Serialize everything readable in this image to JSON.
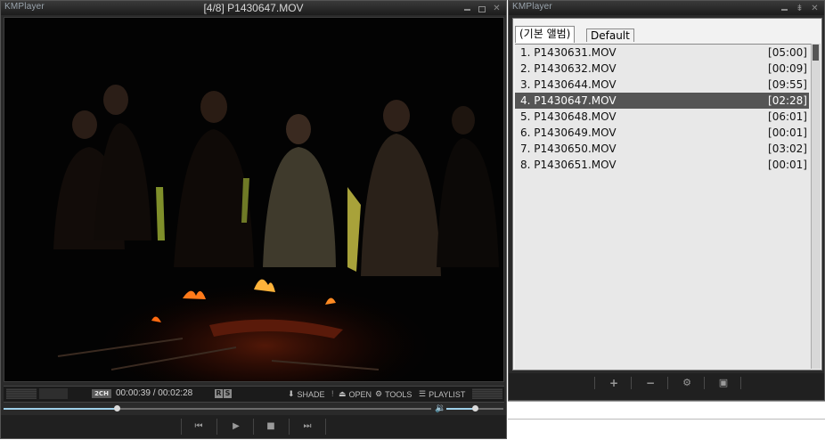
{
  "player": {
    "app_name": "KMPlayer",
    "window_title": "[4/8] P1430647.MOV",
    "channel_badge": "2CH",
    "time_display": "00:00:39 / 00:02:28",
    "rs_r": "R",
    "rs_s": "S",
    "shade_label": "SHADE",
    "open_label": "OPEN",
    "tools_label": "TOOLS",
    "playlist_label": "PLAYLIST",
    "seek_progress": 0.264,
    "volume_level": 0.5
  },
  "playlist": {
    "app_name": "KMPlayer",
    "tabs": [
      {
        "label": "(기본 앨범)",
        "active": true
      },
      {
        "label": "Default",
        "active": false
      }
    ],
    "items": [
      {
        "name": "1. P1430631.MOV",
        "duration": "[05:00]",
        "selected": false
      },
      {
        "name": "2. P1430632.MOV",
        "duration": "[00:09]",
        "selected": false
      },
      {
        "name": "3. P1430644.MOV",
        "duration": "[09:55]",
        "selected": false
      },
      {
        "name": "4. P1430647.MOV",
        "duration": "[02:28]",
        "selected": true
      },
      {
        "name": "5. P1430648.MOV",
        "duration": "[06:01]",
        "selected": false
      },
      {
        "name": "6. P1430649.MOV",
        "duration": "[00:01]",
        "selected": false
      },
      {
        "name": "7. P1430650.MOV",
        "duration": "[03:02]",
        "selected": false
      },
      {
        "name": "8. P1430651.MOV",
        "duration": "[00:01]",
        "selected": false
      }
    ]
  }
}
